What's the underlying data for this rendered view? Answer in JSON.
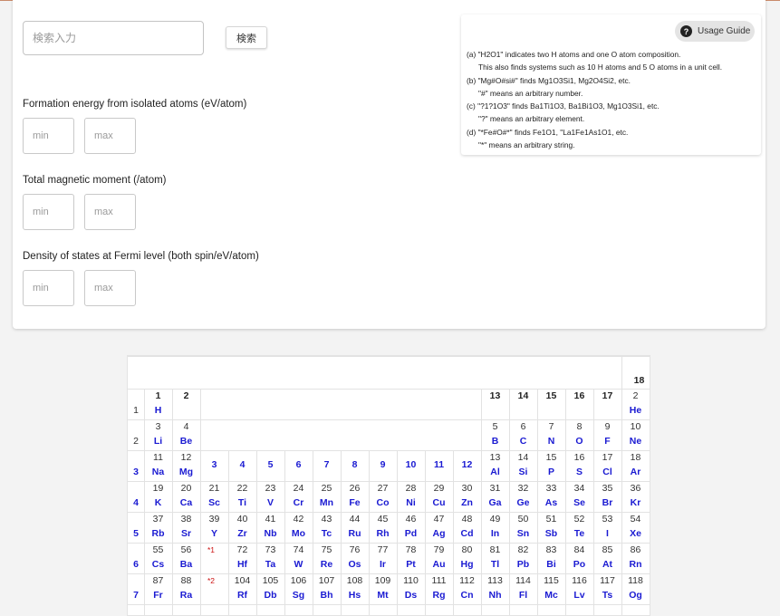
{
  "search": {
    "placeholder": "検索入力",
    "button_label": "検索"
  },
  "filters": [
    {
      "label": "Formation energy from isolated atoms (eV/atom)",
      "min_placeholder": "min",
      "max_placeholder": "max"
    },
    {
      "label": "Total magnetic moment (/atom)",
      "min_placeholder": "min",
      "max_placeholder": "max"
    },
    {
      "label": "Density of states at Fermi level (both spin/eV/atom)",
      "min_placeholder": "min",
      "max_placeholder": "max"
    }
  ],
  "guide": {
    "button_label": "Usage Guide",
    "button_icon": "help-circle-icon",
    "lines": [
      "(a) \"H2O1\" indicates two H atoms and one O atom composition.",
      "This also finds systems such as 10 H atoms and 5 O atoms in a unit cell.",
      "(b) \"Mg#O#si#\" finds Mg1O3Si1, Mg2O4Si2, etc.",
      "\"#\" means an arbitrary number.",
      "(c) \"?1?1O3\" finds Ba1Ti1O3, Ba1Bi1O3, Mg1O3Si1, etc.",
      "\"?\" means an arbitrary element.",
      "(d) \"*Fe#O#*\" finds Fe1O1, \"La1Fe1As1O1, etc.",
      "\"*\" means an arbitrary string."
    ]
  },
  "periodic_table": {
    "group_header_18": "18",
    "group_headers": [
      {
        "group": 1,
        "label": "1"
      },
      {
        "group": 2,
        "label": "2"
      },
      {
        "group": 13,
        "label": "13"
      },
      {
        "group": 14,
        "label": "14"
      },
      {
        "group": 15,
        "label": "15"
      },
      {
        "group": 16,
        "label": "16"
      },
      {
        "group": 17,
        "label": "17"
      }
    ],
    "transition_group_headers": [
      "3",
      "4",
      "5",
      "6",
      "7",
      "8",
      "9",
      "10",
      "11",
      "12"
    ],
    "periods": [
      "1",
      "2",
      "3",
      "4",
      "5",
      "6",
      "7"
    ],
    "lanthanide_note": "*1",
    "actinide_note": "*2",
    "elements": [
      {
        "n": "1",
        "s": "H",
        "p": 1,
        "g": 1
      },
      {
        "n": "2",
        "s": "He",
        "p": 1,
        "g": 18
      },
      {
        "n": "3",
        "s": "Li",
        "p": 2,
        "g": 1
      },
      {
        "n": "4",
        "s": "Be",
        "p": 2,
        "g": 2
      },
      {
        "n": "5",
        "s": "B",
        "p": 2,
        "g": 13
      },
      {
        "n": "6",
        "s": "C",
        "p": 2,
        "g": 14
      },
      {
        "n": "7",
        "s": "N",
        "p": 2,
        "g": 15
      },
      {
        "n": "8",
        "s": "O",
        "p": 2,
        "g": 16
      },
      {
        "n": "9",
        "s": "F",
        "p": 2,
        "g": 17
      },
      {
        "n": "10",
        "s": "Ne",
        "p": 2,
        "g": 18
      },
      {
        "n": "11",
        "s": "Na",
        "p": 3,
        "g": 1
      },
      {
        "n": "12",
        "s": "Mg",
        "p": 3,
        "g": 2
      },
      {
        "n": "13",
        "s": "Al",
        "p": 3,
        "g": 13
      },
      {
        "n": "14",
        "s": "Si",
        "p": 3,
        "g": 14
      },
      {
        "n": "15",
        "s": "P",
        "p": 3,
        "g": 15
      },
      {
        "n": "16",
        "s": "S",
        "p": 3,
        "g": 16
      },
      {
        "n": "17",
        "s": "Cl",
        "p": 3,
        "g": 17
      },
      {
        "n": "18",
        "s": "Ar",
        "p": 3,
        "g": 18
      },
      {
        "n": "19",
        "s": "K",
        "p": 4,
        "g": 1
      },
      {
        "n": "20",
        "s": "Ca",
        "p": 4,
        "g": 2
      },
      {
        "n": "21",
        "s": "Sc",
        "p": 4,
        "g": 3
      },
      {
        "n": "22",
        "s": "Ti",
        "p": 4,
        "g": 4
      },
      {
        "n": "23",
        "s": "V",
        "p": 4,
        "g": 5
      },
      {
        "n": "24",
        "s": "Cr",
        "p": 4,
        "g": 6
      },
      {
        "n": "25",
        "s": "Mn",
        "p": 4,
        "g": 7
      },
      {
        "n": "26",
        "s": "Fe",
        "p": 4,
        "g": 8
      },
      {
        "n": "27",
        "s": "Co",
        "p": 4,
        "g": 9
      },
      {
        "n": "28",
        "s": "Ni",
        "p": 4,
        "g": 10
      },
      {
        "n": "29",
        "s": "Cu",
        "p": 4,
        "g": 11
      },
      {
        "n": "30",
        "s": "Zn",
        "p": 4,
        "g": 12
      },
      {
        "n": "31",
        "s": "Ga",
        "p": 4,
        "g": 13
      },
      {
        "n": "32",
        "s": "Ge",
        "p": 4,
        "g": 14
      },
      {
        "n": "33",
        "s": "As",
        "p": 4,
        "g": 15
      },
      {
        "n": "34",
        "s": "Se",
        "p": 4,
        "g": 16
      },
      {
        "n": "35",
        "s": "Br",
        "p": 4,
        "g": 17
      },
      {
        "n": "36",
        "s": "Kr",
        "p": 4,
        "g": 18
      },
      {
        "n": "37",
        "s": "Rb",
        "p": 5,
        "g": 1
      },
      {
        "n": "38",
        "s": "Sr",
        "p": 5,
        "g": 2
      },
      {
        "n": "39",
        "s": "Y",
        "p": 5,
        "g": 3
      },
      {
        "n": "40",
        "s": "Zr",
        "p": 5,
        "g": 4
      },
      {
        "n": "41",
        "s": "Nb",
        "p": 5,
        "g": 5
      },
      {
        "n": "42",
        "s": "Mo",
        "p": 5,
        "g": 6
      },
      {
        "n": "43",
        "s": "Tc",
        "p": 5,
        "g": 7
      },
      {
        "n": "44",
        "s": "Ru",
        "p": 5,
        "g": 8
      },
      {
        "n": "45",
        "s": "Rh",
        "p": 5,
        "g": 9
      },
      {
        "n": "46",
        "s": "Pd",
        "p": 5,
        "g": 10
      },
      {
        "n": "47",
        "s": "Ag",
        "p": 5,
        "g": 11
      },
      {
        "n": "48",
        "s": "Cd",
        "p": 5,
        "g": 12
      },
      {
        "n": "49",
        "s": "In",
        "p": 5,
        "g": 13
      },
      {
        "n": "50",
        "s": "Sn",
        "p": 5,
        "g": 14
      },
      {
        "n": "51",
        "s": "Sb",
        "p": 5,
        "g": 15
      },
      {
        "n": "52",
        "s": "Te",
        "p": 5,
        "g": 16
      },
      {
        "n": "53",
        "s": "I",
        "p": 5,
        "g": 17
      },
      {
        "n": "54",
        "s": "Xe",
        "p": 5,
        "g": 18
      },
      {
        "n": "55",
        "s": "Cs",
        "p": 6,
        "g": 1
      },
      {
        "n": "56",
        "s": "Ba",
        "p": 6,
        "g": 2
      },
      {
        "n": "72",
        "s": "Hf",
        "p": 6,
        "g": 4
      },
      {
        "n": "73",
        "s": "Ta",
        "p": 6,
        "g": 5
      },
      {
        "n": "74",
        "s": "W",
        "p": 6,
        "g": 6
      },
      {
        "n": "75",
        "s": "Re",
        "p": 6,
        "g": 7
      },
      {
        "n": "76",
        "s": "Os",
        "p": 6,
        "g": 8
      },
      {
        "n": "77",
        "s": "Ir",
        "p": 6,
        "g": 9
      },
      {
        "n": "78",
        "s": "Pt",
        "p": 6,
        "g": 10
      },
      {
        "n": "79",
        "s": "Au",
        "p": 6,
        "g": 11
      },
      {
        "n": "80",
        "s": "Hg",
        "p": 6,
        "g": 12
      },
      {
        "n": "81",
        "s": "Tl",
        "p": 6,
        "g": 13
      },
      {
        "n": "82",
        "s": "Pb",
        "p": 6,
        "g": 14
      },
      {
        "n": "83",
        "s": "Bi",
        "p": 6,
        "g": 15
      },
      {
        "n": "84",
        "s": "Po",
        "p": 6,
        "g": 16
      },
      {
        "n": "85",
        "s": "At",
        "p": 6,
        "g": 17
      },
      {
        "n": "86",
        "s": "Rn",
        "p": 6,
        "g": 18
      },
      {
        "n": "87",
        "s": "Fr",
        "p": 7,
        "g": 1
      },
      {
        "n": "88",
        "s": "Ra",
        "p": 7,
        "g": 2
      },
      {
        "n": "104",
        "s": "Rf",
        "p": 7,
        "g": 4
      },
      {
        "n": "105",
        "s": "Db",
        "p": 7,
        "g": 5
      },
      {
        "n": "106",
        "s": "Sg",
        "p": 7,
        "g": 6
      },
      {
        "n": "107",
        "s": "Bh",
        "p": 7,
        "g": 7
      },
      {
        "n": "108",
        "s": "Hs",
        "p": 7,
        "g": 8
      },
      {
        "n": "109",
        "s": "Mt",
        "p": 7,
        "g": 9
      },
      {
        "n": "110",
        "s": "Ds",
        "p": 7,
        "g": 10
      },
      {
        "n": "111",
        "s": "Rg",
        "p": 7,
        "g": 11
      },
      {
        "n": "112",
        "s": "Cn",
        "p": 7,
        "g": 12
      },
      {
        "n": "113",
        "s": "Nh",
        "p": 7,
        "g": 13
      },
      {
        "n": "114",
        "s": "Fl",
        "p": 7,
        "g": 14
      },
      {
        "n": "115",
        "s": "Mc",
        "p": 7,
        "g": 15
      },
      {
        "n": "116",
        "s": "Lv",
        "p": 7,
        "g": 16
      },
      {
        "n": "117",
        "s": "Ts",
        "p": 7,
        "g": 17
      },
      {
        "n": "118",
        "s": "Og",
        "p": 7,
        "g": 18
      }
    ]
  },
  "colors": {
    "element_symbol": "#1a1ad2",
    "transition_header": "#1a1ad2",
    "note": "#cc1111",
    "accent_line": "#c98a6a"
  }
}
